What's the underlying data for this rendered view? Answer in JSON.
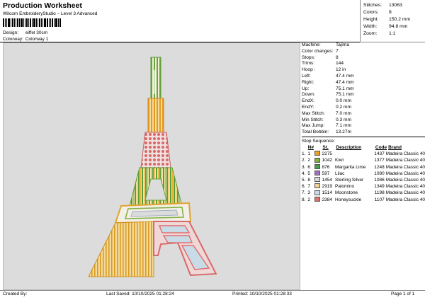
{
  "header": {
    "title": "Production Worksheet",
    "subtitle": "Wilcom EmbroideryStudio – Level 3 Advanced",
    "design_label": "Design:",
    "design_value": "eiffel 30cm",
    "colorway_label": "Colorway:",
    "colorway_value": "Colorway 1"
  },
  "stats": [
    {
      "k": "Stitches:",
      "v": "13063"
    },
    {
      "k": "Colors:",
      "v": "8"
    },
    {
      "k": "Height:",
      "v": "150.2 mm"
    },
    {
      "k": "Width:",
      "v": "94.8 mm"
    },
    {
      "k": "Zoom:",
      "v": "1:1"
    }
  ],
  "machine": [
    {
      "k": "Machine:",
      "v": "Tajima"
    },
    {
      "k": "Color changes:",
      "v": "7"
    },
    {
      "k": "Stops:",
      "v": "8"
    },
    {
      "k": "Trims:",
      "v": "144"
    },
    {
      "k": "Hoop :",
      "v": "12 in"
    },
    {
      "k": "Left:",
      "v": "47.4 mm"
    },
    {
      "k": "Right:",
      "v": "47.4 mm"
    },
    {
      "k": "Up:",
      "v": "75.1 mm"
    },
    {
      "k": "Down:",
      "v": "75.1 mm"
    },
    {
      "k": "EndX:",
      "v": "0.0 mm"
    },
    {
      "k": "EndY:",
      "v": "0.2 mm"
    },
    {
      "k": "Max Stitch:",
      "v": "7.0 mm"
    },
    {
      "k": "Min Stitch:",
      "v": "0.3 mm"
    },
    {
      "k": "Max Jump:",
      "v": "7.1 mm"
    },
    {
      "k": "Total Bobbin:",
      "v": "13.27m"
    }
  ],
  "sequence": {
    "title": "Stop Sequence:",
    "headers": {
      "no": "N#",
      "st": "St.",
      "desc": "Description",
      "code": "Code",
      "brand": "Brand"
    },
    "rows": [
      {
        "a": "1.",
        "b": "1",
        "color": "#f0a020",
        "n": "2275",
        "desc": "",
        "code": "1437",
        "brand": "Madeira Classic 40"
      },
      {
        "a": "2.",
        "b": "2",
        "color": "#7fb040",
        "n": "1042",
        "desc": "Kiwi",
        "code": "1377",
        "brand": "Madeira Classic 40"
      },
      {
        "a": "3.",
        "b": "6",
        "color": "#4a9a50",
        "n": "876",
        "desc": "Margarita Lime",
        "code": "1248",
        "brand": "Madeira Classic 40"
      },
      {
        "a": "4.",
        "b": "5",
        "color": "#a070c0",
        "n": "597",
        "desc": "Lilac",
        "code": "1080",
        "brand": "Madeira Classic 40"
      },
      {
        "a": "5.",
        "b": "8",
        "color": "#d8d8d8",
        "n": "1454",
        "desc": "Sterling Silver",
        "code": "1086",
        "brand": "Madeira Classic 40"
      },
      {
        "a": "6.",
        "b": "7",
        "color": "#f3d090",
        "n": "2919",
        "desc": "Palomino",
        "code": "1349",
        "brand": "Madeira Classic 40"
      },
      {
        "a": "7.",
        "b": "3",
        "color": "#c8dce8",
        "n": "1514",
        "desc": "Moonstone",
        "code": "1198",
        "brand": "Madeira Classic 40"
      },
      {
        "a": "8.",
        "b": "2",
        "color": "#e07070",
        "n": "2384",
        "desc": "Honeysuckle",
        "code": "1107",
        "brand": "Madeira Classic 40"
      }
    ]
  },
  "footer": {
    "created": "Created By:",
    "saved": "Last Saved: 10/10/2025 01:28:24",
    "printed": "Printed: 10/10/2025 01:28:33",
    "page": "Page 1 of 1"
  }
}
